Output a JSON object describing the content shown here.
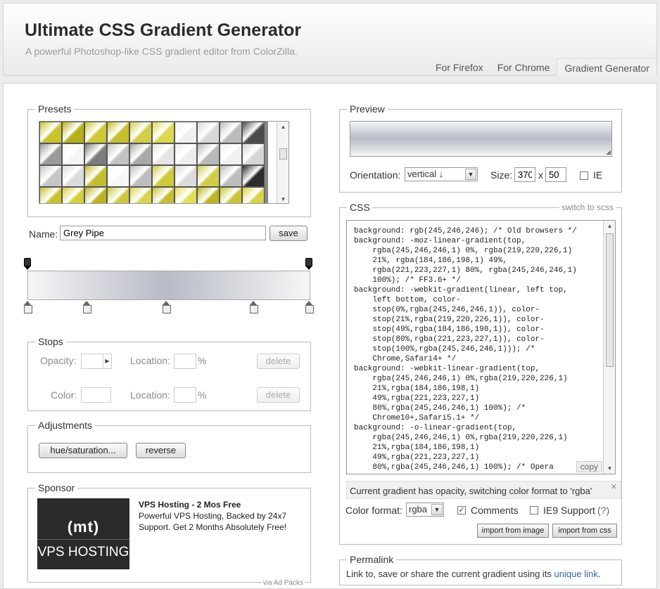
{
  "header": {
    "title": "Ultimate CSS Gradient Generator",
    "subtitle": "A powerful Photoshop-like CSS gradient editor from ColorZilla.",
    "nav": [
      "For Firefox",
      "For Chrome",
      "Gradient Generator"
    ]
  },
  "presets": {
    "legend": "Presets",
    "swatches": [
      "#c9c42a",
      "#b5b018",
      "#cdc835",
      "#c4bf2c",
      "#d2cd48",
      "#ddd94f",
      "#f0f0f0",
      "#d8d8d8",
      "#bcbcbc",
      "#4a4a4a",
      "#9a9a9a",
      "#f5f5f5",
      "#7d7d7d",
      "#c3c3c3",
      "#a8a8a8",
      "#e5e5e5",
      "#ededed",
      "#b9b9b9",
      "#f0f0f0",
      "#d6d6d6",
      "#c6c6c6",
      "#dcdcdc",
      "#c3be30",
      "#f7f7f7",
      "#bdbdbd",
      "#d0cb3a",
      "#dcdcdc",
      "#d2cd48",
      "#bcbcbc",
      "#2c2c2c",
      "#c8c32a",
      "#d4cf3c",
      "#b9b41e",
      "#cdc840",
      "#d9d54c",
      "#c4bf32",
      "#e3df55",
      "#bab520",
      "#c9c435",
      "#d8d344"
    ]
  },
  "name": {
    "label": "Name:",
    "value": "Grey Pipe",
    "save": "save"
  },
  "stops": {
    "legend": "Stops",
    "opacity": "Opacity:",
    "location": "Location:",
    "color": "Color:",
    "pct": "%",
    "delete": "delete"
  },
  "adjustments": {
    "legend": "Adjustments",
    "hue": "hue/saturation...",
    "reverse": "reverse"
  },
  "sponsor": {
    "legend": "Sponsor",
    "logo": "(mt)",
    "logo_sub": "VPS HOSTING",
    "title": "VPS Hosting - 2 Mos Free",
    "line1": "Powerful VPS Hosting, Backed by 24x7",
    "line2": "Support. Get 2 Months Absolutely Free!",
    "via": "via Ad Packs"
  },
  "preview": {
    "legend": "Preview",
    "orientation_label": "Orientation:",
    "orientation": "vertical ↓",
    "size_label": "Size:",
    "w": "370",
    "x": "x",
    "h": "50",
    "ie": "IE"
  },
  "css": {
    "legend": "CSS",
    "switch": "switch to scss",
    "copy": "copy",
    "code": "background: rgb(245,246,246); /* Old browsers */\nbackground: -moz-linear-gradient(top,\n    rgba(245,246,246,1) 0%, rgba(219,220,226,1)\n    21%, rgba(184,186,198,1) 49%,\n    rgba(221,223,227,1) 80%, rgba(245,246,246,1)\n    100%); /* FF3.6+ */\nbackground: -webkit-gradient(linear, left top,\n    left bottom, color-\n    stop(0%,rgba(245,246,246,1)), color-\n    stop(21%,rgba(219,220,226,1)), color-\n    stop(49%,rgba(184,186,198,1)), color-\n    stop(80%,rgba(221,223,227,1)), color-\n    stop(100%,rgba(245,246,246,1))); /*\n    Chrome,Safari4+ */\nbackground: -webkit-linear-gradient(top,\n    rgba(245,246,246,1) 0%,rgba(219,220,226,1)\n    21%,rgba(184,186,198,1)\n    49%,rgba(221,223,227,1)\n    80%,rgba(245,246,246,1) 100%); /*\n    Chrome10+,Safari5.1+ */\nbackground: -o-linear-gradient(top,\n    rgba(245,246,246,1) 0%,rgba(219,220,226,1)\n    21%,rgba(184,186,198,1)\n    49%,rgba(221,223,227,1)\n    80%,rgba(245,246,246,1) 100%); /* Opera",
    "note": "Current gradient has opacity, switching color format to 'rgba'",
    "format_label": "Color format:",
    "format": "rgba",
    "comments": "Comments",
    "ie9": "IE9 Support",
    "ie9_help": "(?)",
    "import_image": "import from image",
    "import_css": "import from css"
  },
  "permalink": {
    "legend": "Permalink",
    "text": "Link to, save or share the current gradient using its ",
    "link": "unique link",
    "end": "."
  }
}
